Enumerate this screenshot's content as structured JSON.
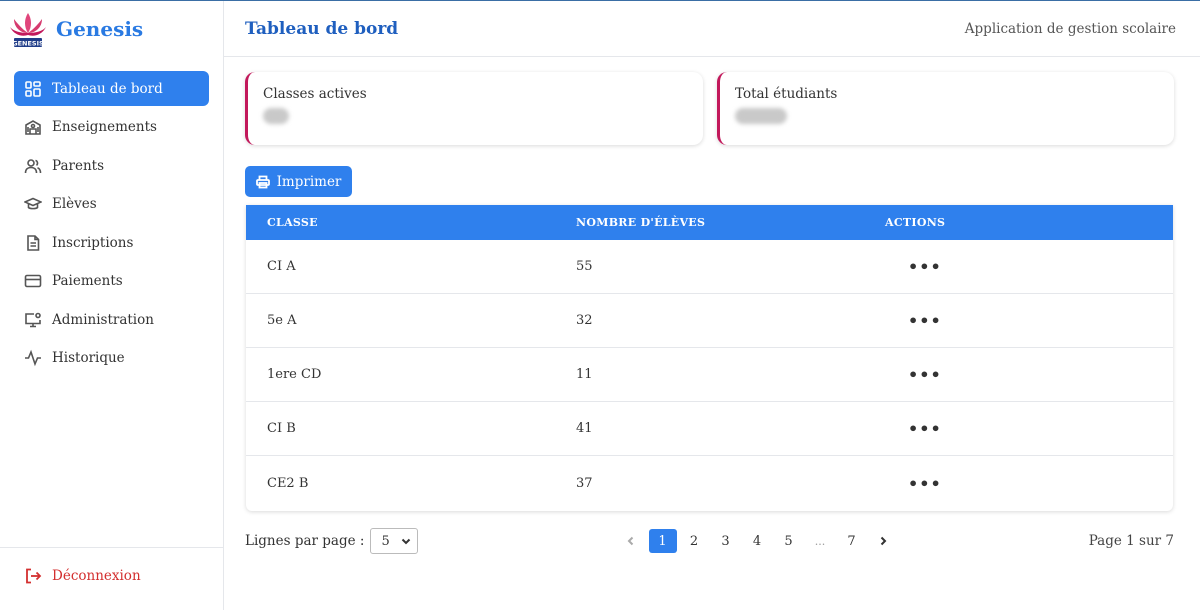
{
  "brand": {
    "name": "Genesis",
    "logo_icon": "lotus-logo-icon"
  },
  "sidebar": {
    "items": [
      {
        "label": "Tableau de bord",
        "icon": "dashboard-grid-icon",
        "active": true
      },
      {
        "label": "Enseignements",
        "icon": "school-building-icon"
      },
      {
        "label": "Parents",
        "icon": "users-icon"
      },
      {
        "label": "Elèves",
        "icon": "graduation-cap-icon"
      },
      {
        "label": "Inscriptions",
        "icon": "document-icon"
      },
      {
        "label": "Paiements",
        "icon": "credit-card-icon"
      },
      {
        "label": "Administration",
        "icon": "monitor-gear-icon"
      },
      {
        "label": "Historique",
        "icon": "activity-icon"
      }
    ],
    "logout": {
      "label": "Déconnexion",
      "icon": "logout-icon"
    }
  },
  "header": {
    "title": "Tableau de bord",
    "subtitle": "Application de gestion scolaire"
  },
  "cards": {
    "classes": {
      "label": "Classes actives"
    },
    "students": {
      "label": "Total étudiants"
    }
  },
  "toolbar": {
    "print_label": "Imprimer",
    "print_icon": "printer-icon"
  },
  "table": {
    "columns": [
      "CLASSE",
      "NOMBRE D'ÉLÈVES",
      "ACTIONS"
    ],
    "rows": [
      {
        "classe": "CI A",
        "count": "55",
        "action": "•••"
      },
      {
        "classe": "5e A",
        "count": "32",
        "action": "•••"
      },
      {
        "classe": "1ere CD",
        "count": "11",
        "action": "•••"
      },
      {
        "classe": "CI B",
        "count": "41",
        "action": "•••"
      },
      {
        "classe": "CE2 B",
        "count": "37",
        "action": "•••"
      }
    ]
  },
  "pagination": {
    "rows_label": "Lignes par page :",
    "rows_value": "5",
    "pages": [
      "1",
      "2",
      "3",
      "4",
      "5",
      "...",
      "7"
    ],
    "current": "1",
    "info": "Page 1 sur 7"
  },
  "colors": {
    "accent": "#2f80ed",
    "card_border": "#c2185b",
    "logout": "#d32f2f"
  }
}
